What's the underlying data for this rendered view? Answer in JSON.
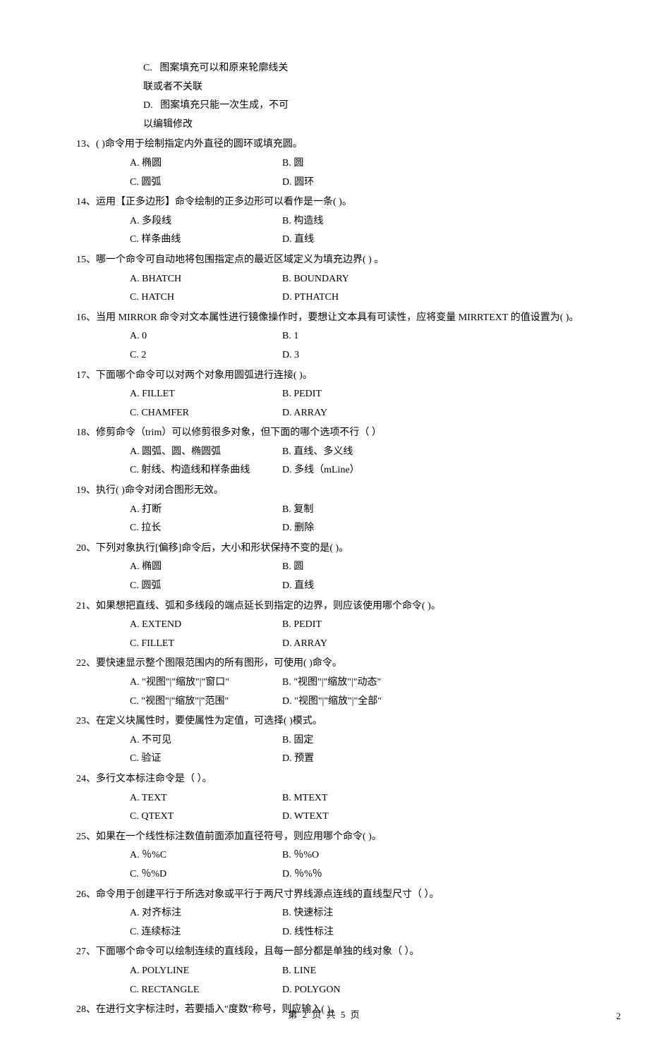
{
  "leadOptions": [
    {
      "label": "C.",
      "text": "图案填充可以和原来轮廓线关联或者不关联"
    },
    {
      "label": "D.",
      "text": "图案填充只能一次生成，不可以编辑修改"
    }
  ],
  "questions": [
    {
      "num": "13、",
      "text": "(       )命令用于绘制指定内外直径的圆环或填充圆。",
      "opts": [
        {
          "a": "A. 椭圆",
          "b": "B. 圆"
        },
        {
          "a": "C. 圆弧",
          "b": "D. 圆环"
        }
      ]
    },
    {
      "num": "14、",
      "text": "运用【正多边形】命令绘制的正多边形可以看作是一条(       )。",
      "opts": [
        {
          "a": "A. 多段线",
          "b": "B. 构造线"
        },
        {
          "a": "C. 样条曲线",
          "b": "D. 直线"
        }
      ]
    },
    {
      "num": "15、",
      "text": "哪一个命令可自动地将包围指定点的最近区域定义为填充边界(        )  。",
      "opts": [
        {
          "a": "A. BHATCH",
          "b": "B. BOUNDARY"
        },
        {
          "a": "C. HATCH",
          "b": "D. PTHATCH"
        }
      ]
    },
    {
      "num": "16、",
      "text": "当用 MIRROR 命令对文本属性进行镜像操作时，要想让文本具有可读性，应将变量 MIRRTEXT 的值设置为(         )。",
      "opts": [
        {
          "a": "A. 0",
          "b": "B.  1"
        },
        {
          "a": "C. 2",
          "b": "D.  3"
        }
      ]
    },
    {
      "num": "17、",
      "text": "下面哪个命令可以对两个对象用圆弧进行连接(          )。",
      "opts": [
        {
          "a": "A. FILLET",
          "b": "B. PEDIT"
        },
        {
          "a": "C. CHAMFER",
          "b": "D. ARRAY"
        }
      ]
    },
    {
      "num": "18、",
      "text": "修剪命令（trim）可以修剪很多对象，但下面的哪个选项不行（        ）",
      "opts": [
        {
          "a": "A. 圆弧、圆、椭圆弧",
          "b": "B. 直线、多义线"
        },
        {
          "a": "C. 射线、构造线和样条曲线",
          "b": "D. 多线（mLine）"
        }
      ]
    },
    {
      "num": "19、",
      "text": "执行(           )命令对闭合图形无效。",
      "opts": [
        {
          "a": "A. 打断",
          "b": "B. 复制"
        },
        {
          "a": "C. 拉长",
          "b": "D. 删除"
        }
      ]
    },
    {
      "num": "20、",
      "text": "下列对象执行[偏移]命令后，大小和形状保持不变的是(          )。",
      "opts": [
        {
          "a": "A. 椭圆",
          "b": "B. 圆"
        },
        {
          "a": "C. 圆弧",
          "b": "D. 直线"
        }
      ]
    },
    {
      "num": "21、",
      "text": "如果想把直线、弧和多线段的端点延长到指定的边界，则应该使用哪个命令(        )。",
      "opts": [
        {
          "a": "A. EXTEND",
          "b": "B. PEDIT"
        },
        {
          "a": "C. FILLET",
          "b": "D. ARRAY"
        }
      ]
    },
    {
      "num": "22、",
      "text": "要快速显示整个图限范围内的所有图形，可使用(          )命令。",
      "opts": [
        {
          "a": "A. \"视图\"|\"缩放\"|\"窗口\"",
          "b": "B. \"视图\"|\"缩放\"|\"动态\""
        },
        {
          "a": "C. \"视图\"|\"缩放\"|\"范围\"",
          "b": "D. \"视图\"|\"缩放\"|\"全部\""
        }
      ]
    },
    {
      "num": "23、",
      "text": "在定义块属性时，要使属性为定值，可选择(        )模式。",
      "opts": [
        {
          "a": "A. 不可见",
          "b": "B. 固定"
        },
        {
          "a": "C. 验证",
          "b": "D. 预置"
        }
      ]
    },
    {
      "num": "24、",
      "text": "多行文本标注命令是（       ）。",
      "opts": [
        {
          "a": "A. TEXT",
          "b": "B. MTEXT"
        },
        {
          "a": "C. QTEXT",
          "b": "D. WTEXT"
        }
      ]
    },
    {
      "num": "25、",
      "text": "如果在一个线性标注数值前面添加直径符号，则应用哪个命令(           )。",
      "opts": [
        {
          "a": "A.    ％%C",
          "b": "B. ％%O"
        },
        {
          "a": "C.    ％%D",
          "b": "D. ％%％"
        }
      ]
    },
    {
      "num": "26、",
      "text": "命令用于创建平行于所选对象或平行于两尺寸界线源点连线的直线型尺寸（       ）。",
      "opts": [
        {
          "a": "A. 对齐标注",
          "b": "B. 快速标注"
        },
        {
          "a": "C. 连续标注",
          "b": "D. 线性标注"
        }
      ]
    },
    {
      "num": "27、",
      "text": "下面哪个命令可以绘制连续的直线段，且每一部分都是单独的线对象（      ）。",
      "opts": [
        {
          "a": "A. POLYLINE",
          "b": "B. LINE"
        },
        {
          "a": "C. RECTANGLE",
          "b": "D. POLYGON"
        }
      ]
    },
    {
      "num": "28、",
      "text": "在进行文字标注时，若要插入\"度数\"称号，则应输入(        )。",
      "opts": []
    }
  ],
  "footer": "第 2 页 共 5 页",
  "pageNumRight": "2"
}
